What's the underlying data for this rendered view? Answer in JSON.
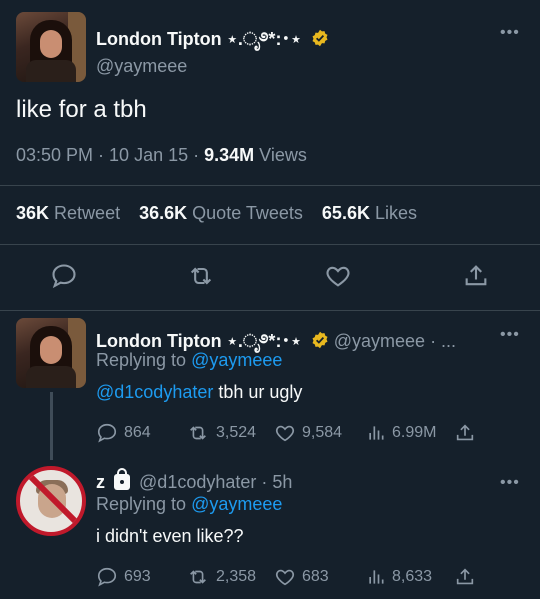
{
  "main_tweet": {
    "display_name": "London Tipton ⋆.ೃ࿔*:･⋆",
    "handle": "@yaymeee",
    "text": "like for a tbh",
    "time": "03:50 PM",
    "date": "10 Jan 15",
    "views_count": "9.34M",
    "views_label": "Views",
    "retweets_count": "36K",
    "retweets_label": "Retweet",
    "quotes_count": "36.6K",
    "quotes_label": "Quote Tweets",
    "likes_count": "65.6K",
    "likes_label": "Likes"
  },
  "reply1": {
    "display_name": "London Tipton ⋆.ೃ࿔*:･⋆",
    "handle": "@yaymeee",
    "trailing": "· ...",
    "replying_label": "Replying to",
    "replying_to": "@yaymeee",
    "mention": "@d1codyhater",
    "text": "tbh ur ugly",
    "replies": "864",
    "retweets": "3,524",
    "likes": "9,584",
    "views": "6.99M"
  },
  "reply2": {
    "display_name": "z",
    "handle": "@d1codyhater",
    "time": "· 5h",
    "replying_label": "Replying to",
    "replying_to": "@yaymeee",
    "text": "i didn't even like??",
    "replies": "693",
    "retweets": "2,358",
    "likes": "683",
    "views": "8,633"
  },
  "colors": {
    "background": "#15202b",
    "link": "#1d9bf0",
    "muted": "#8b98a5",
    "verified": "#e8b81f"
  }
}
